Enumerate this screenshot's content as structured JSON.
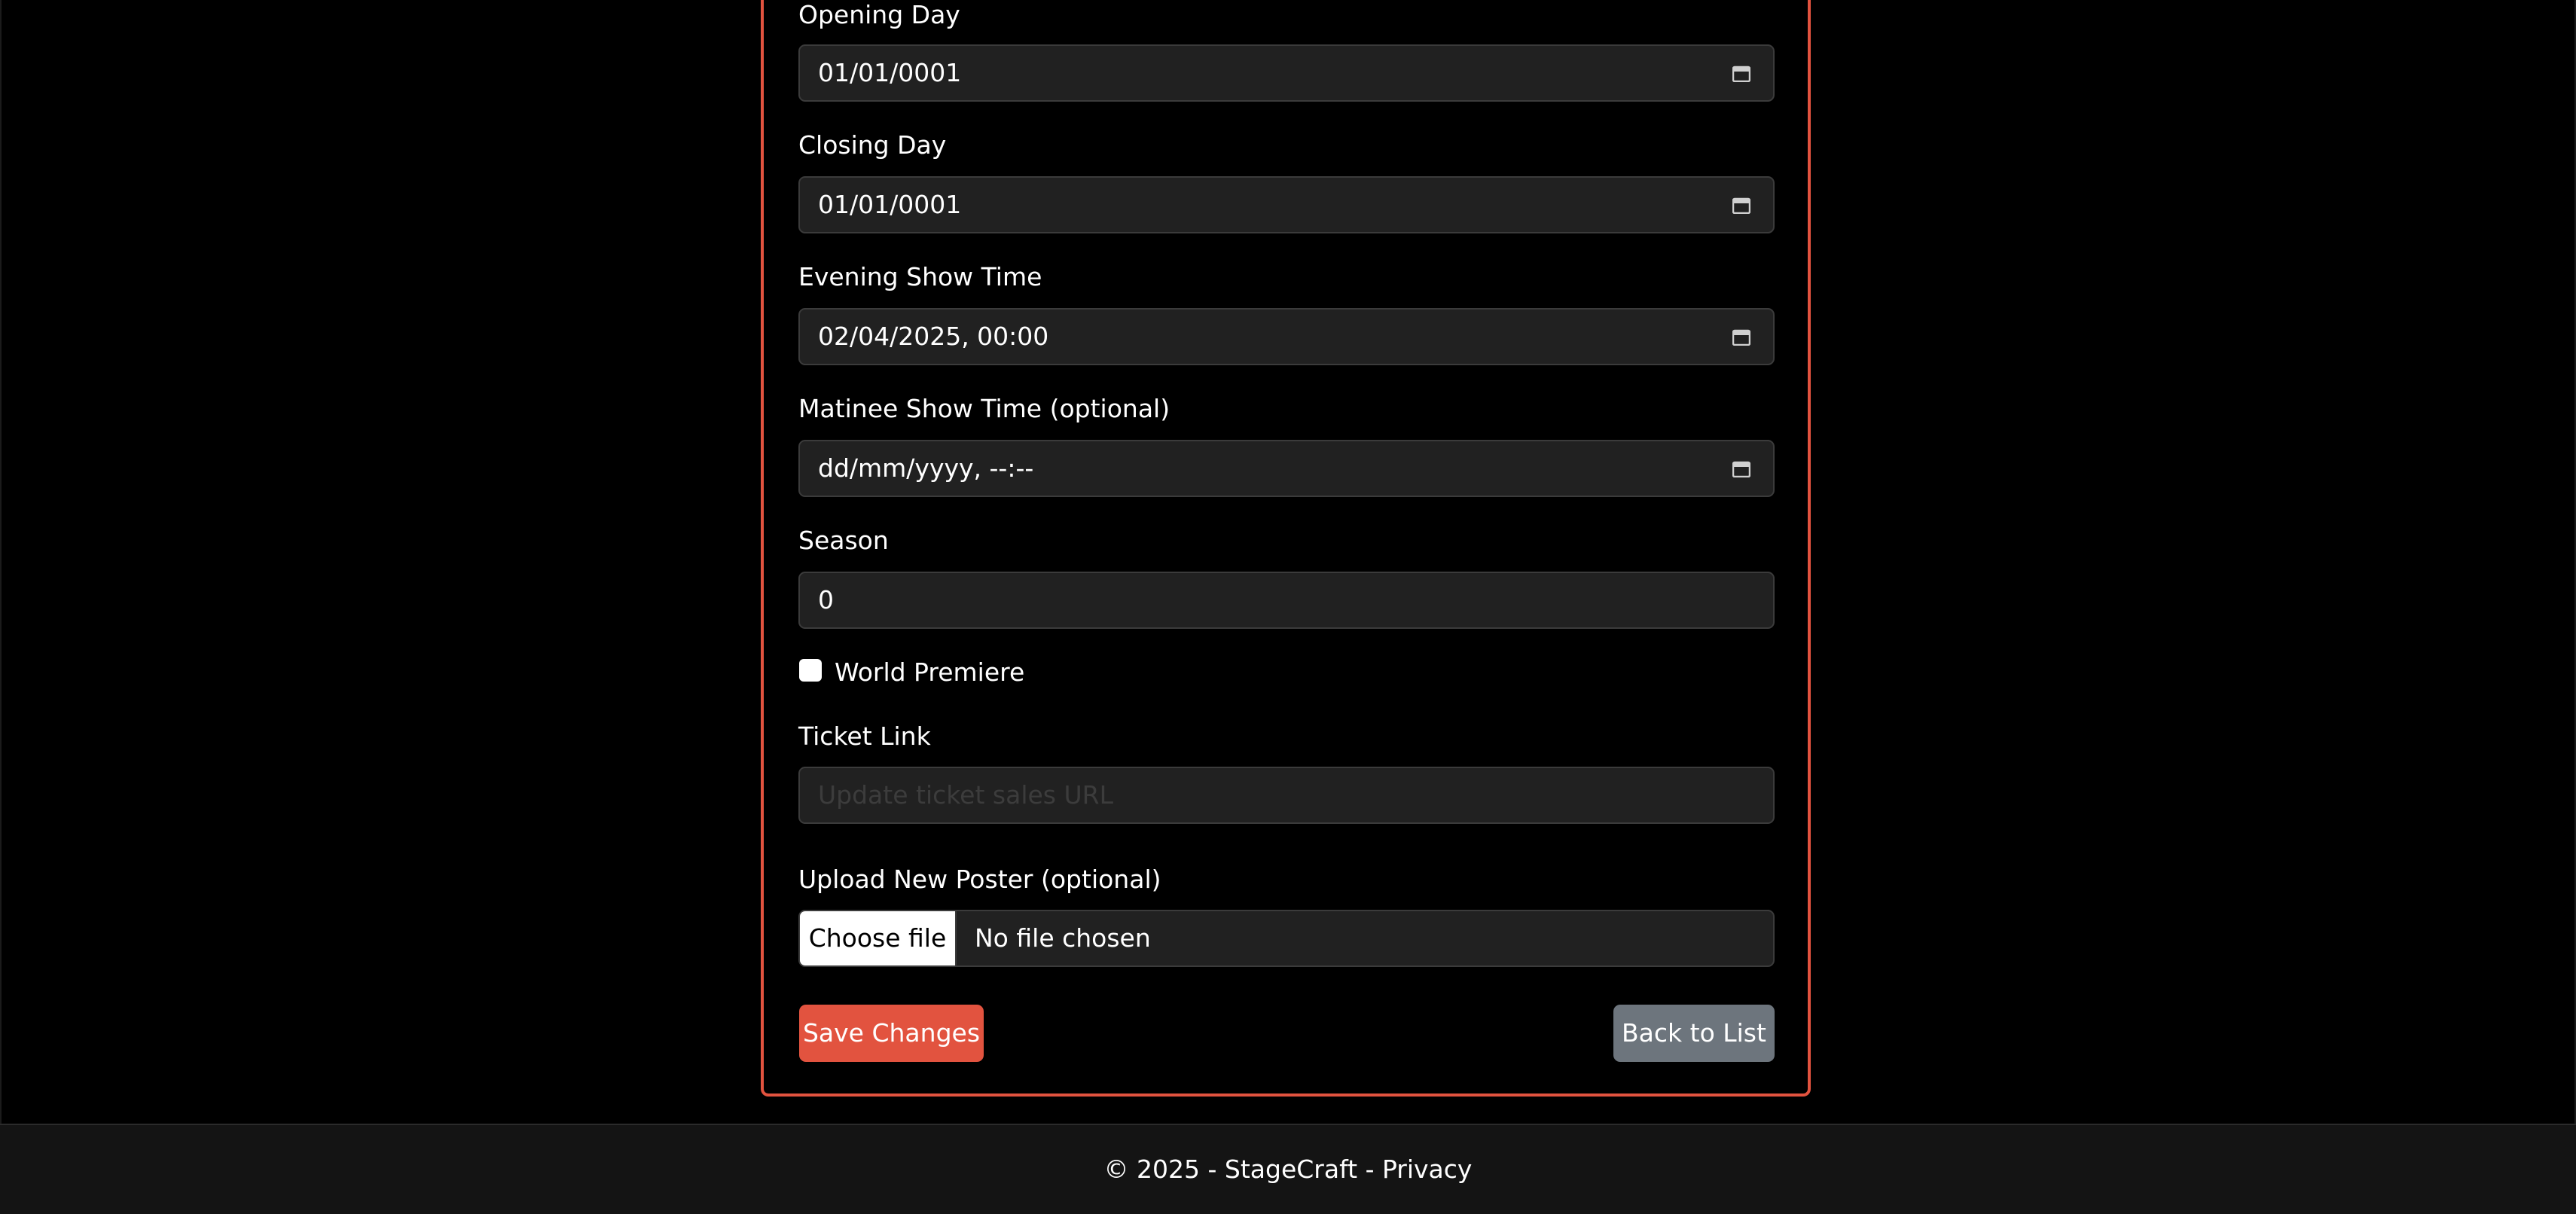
{
  "form": {
    "opening_day": {
      "label": "Opening Day",
      "value": "01/01/0001"
    },
    "closing_day": {
      "label": "Closing Day",
      "value": "01/01/0001"
    },
    "evening_show_time": {
      "label": "Evening Show Time",
      "value": "02/04/2025, 00:00"
    },
    "matinee_show_time": {
      "label": "Matinee Show Time (optional)",
      "value": "dd/mm/yyyy, --:--"
    },
    "season": {
      "label": "Season",
      "value": "0"
    },
    "world_premiere": {
      "label": "World Premiere",
      "checked": false
    },
    "ticket_link": {
      "label": "Ticket Link",
      "placeholder": "Update ticket sales URL",
      "value": ""
    },
    "poster": {
      "label": "Upload New Poster (optional)",
      "button_label": "Choose file",
      "status": "No file chosen"
    }
  },
  "actions": {
    "save_label": "Save Changes",
    "back_label": "Back to List"
  },
  "footer": {
    "text": "© 2025 - StageCraft - Privacy"
  },
  "colors": {
    "accent": "#e2533f",
    "secondary_button": "#6d757d",
    "input_background": "#212121",
    "page_background": "#000000",
    "footer_background": "#141414"
  },
  "icons": {
    "calendar": "calendar-icon"
  }
}
